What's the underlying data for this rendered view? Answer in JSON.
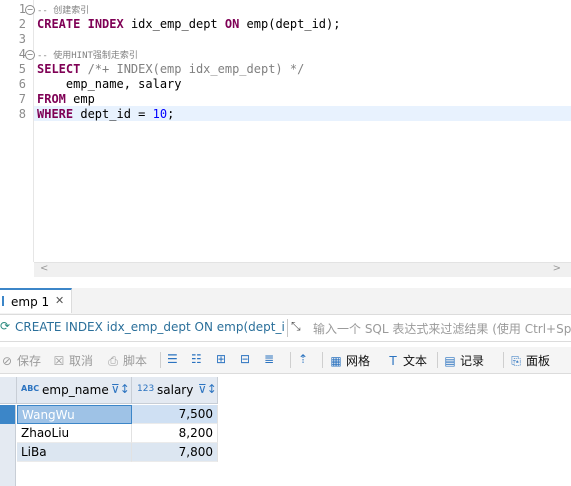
{
  "editor": {
    "lines": [
      "1",
      "2",
      "3",
      "4",
      "5",
      "6",
      "7",
      "8"
    ],
    "comment1": "-- 创建索引",
    "line2": {
      "create": "CREATE",
      "index": "INDEX",
      "name": " idx_emp_dept ",
      "on": "ON",
      "rest": " emp(dept_id);"
    },
    "comment2": "-- 使用HINT强制走索引",
    "line5": {
      "select": "SELECT",
      "hint": " /*+ INDEX(emp idx_emp_dept) */"
    },
    "line6": "    emp_name, salary",
    "line7": {
      "from": "FROM",
      "rest": " emp"
    },
    "line8": {
      "where": "WHERE",
      "rest": " dept_id = ",
      "value": "10",
      "end": ";"
    }
  },
  "result_tab": {
    "label": "emp 1",
    "close": "✕"
  },
  "filter": {
    "query": "CREATE INDEX idx_emp_dept ON emp(dept_id",
    "placeholder": "输入一个 SQL 表达式来过滤结果 (使用 Ctrl+Spa"
  },
  "toolbar": {
    "save": "保存",
    "cancel": "取消",
    "script": "脚本",
    "grid": "网格",
    "text": "文本",
    "record": "记录",
    "panel": "面板"
  },
  "grid": {
    "columns": [
      {
        "type": "ABC",
        "name": "emp_name"
      },
      {
        "type": "123",
        "name": "salary"
      }
    ],
    "rows": [
      {
        "emp_name": "WangWu",
        "salary": "7,500"
      },
      {
        "emp_name": "ZhaoLiu",
        "salary": "8,200"
      },
      {
        "emp_name": "LiBa",
        "salary": "7,800"
      }
    ]
  },
  "colors": {
    "accent": "#3c86c8",
    "selected_row": "#cfe0f3",
    "selected_cell": "#9ec2e6",
    "keyword": "#7f0055",
    "number": "#0000ff"
  }
}
